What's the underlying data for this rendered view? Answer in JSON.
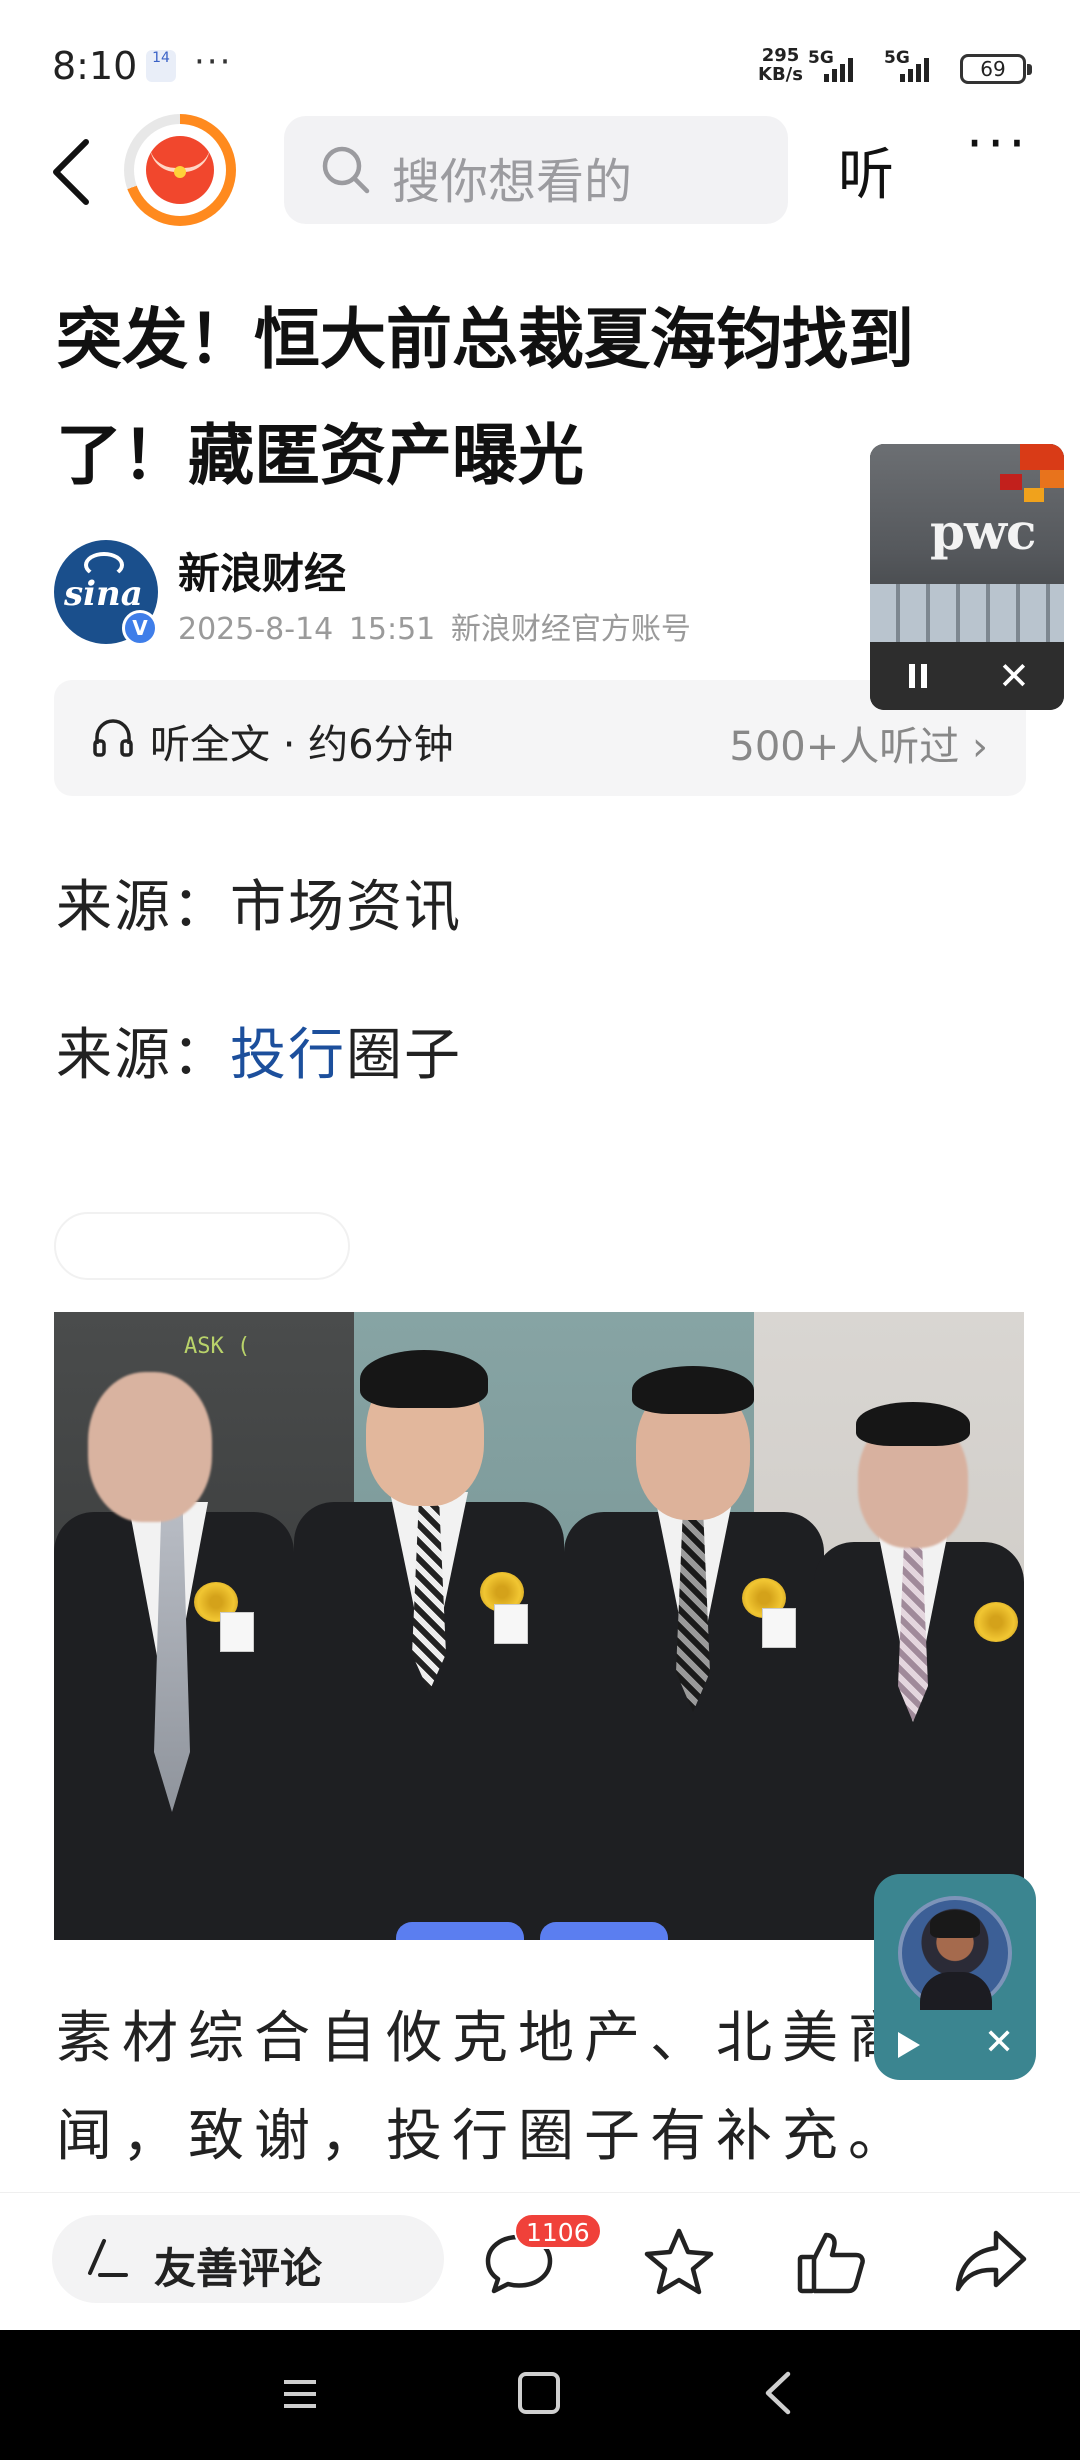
{
  "status_bar": {
    "time": "8:10",
    "calendar_day": "14",
    "more": "···",
    "net_speed_value": "295",
    "net_speed_unit": "KB/s",
    "signal1_label": "5G",
    "signal2_label": "5G",
    "battery": "69"
  },
  "nav": {
    "search_placeholder": "搜你想看的",
    "listen_label": "听",
    "more_label": "···"
  },
  "article": {
    "headline": "突发！恒大前总裁夏海钧找到了！藏匿资产曝光",
    "author_name": "新浪财经",
    "author_avatar_text": "sina",
    "author_date": "2025-8-14",
    "author_time": "15:51",
    "author_account": "新浪财经官方账号",
    "listen_full": "听全文 · 约6分钟",
    "listen_count": "500+人听过",
    "source1_prefix": "来源：",
    "source1_value": "市场资讯",
    "source2_prefix": "来源：",
    "source2_link": "投行",
    "source2_rest": "圈子",
    "photo_sign_text": "ASK (",
    "body_text": "素材综合自攸克地产、北美商闻，致谢，投行圈子有补充。"
  },
  "floating_video": {
    "logo_text": "pwc",
    "pause_icon": "pause-icon",
    "close_label": "✕"
  },
  "mini_widget": {
    "close_label": "✕"
  },
  "bottom_bar": {
    "comment_label": "友善评论",
    "comment_count": "1106",
    "icons": [
      "comment-icon",
      "star-icon",
      "thumbs-up-icon",
      "share-icon"
    ]
  },
  "colors": {
    "link": "#1c4f9c",
    "badge": "#f0413a",
    "app_accent": "#f1472d",
    "widget_bg": "#3b8590"
  }
}
